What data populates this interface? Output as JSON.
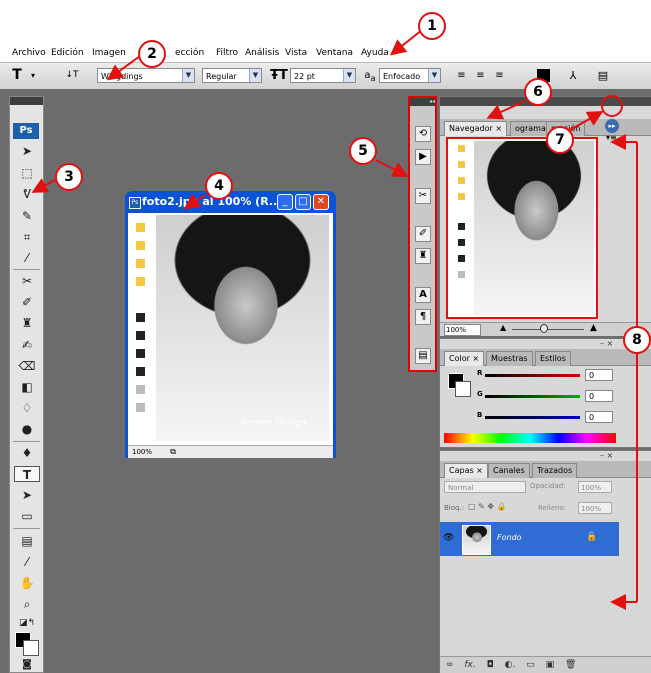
{
  "menubar": {
    "items": [
      "Archivo",
      "Edición",
      "Imagen",
      "",
      "ección",
      "Filtro",
      "Análisis",
      "Vista",
      "Ventana",
      "Ayuda"
    ]
  },
  "options": {
    "tool_glyph": "T",
    "font_family": "Wingdings",
    "font_style": "Regular",
    "font_size": "22 pt",
    "aa_label": "a",
    "aa_mode": "Enfocado"
  },
  "toolbox": {
    "logo": "Ps"
  },
  "document": {
    "title": "foto2.jpg al 100% (R...",
    "zoom": "100%",
    "swatch_colors": [
      "#f5c842",
      "#f5c842",
      "#f5c842",
      "#f5c842",
      "#222222",
      "#222222",
      "#222222",
      "#222222",
      "#bcbcbc",
      "#bcbcbc"
    ],
    "signature": "Romen Design"
  },
  "navigator": {
    "tabs": [
      "Navegador",
      "ograma",
      "mación"
    ],
    "zoom": "100%",
    "zoom_slider_level": 0.45
  },
  "color_panel": {
    "tabs": [
      "Color",
      "Muestras",
      "Estilos"
    ],
    "channels": [
      {
        "label": "R",
        "value": "0",
        "color": "#e00000"
      },
      {
        "label": "G",
        "value": "0",
        "color": "#00b000"
      },
      {
        "label": "B",
        "value": "0",
        "color": "#0000c8"
      }
    ]
  },
  "layers_panel": {
    "tabs": [
      "Capas",
      "Canales",
      "Trazados"
    ],
    "blend_mode": "Normal",
    "opacity_label": "Opacidad:",
    "opacity_value": "100%",
    "lock_label": "Bloq.:",
    "fill_label": "Relleno:",
    "fill_value": "100%",
    "layer_name": "Fondo"
  },
  "annotations": [
    "1",
    "2",
    "3",
    "4",
    "5",
    "6",
    "7",
    "8"
  ],
  "colors": {
    "annotation_red": "#e31010",
    "titlebar_blue": "#0b53d6",
    "layer_selected": "#2f6cd4",
    "workspace": "#6c6c6c"
  }
}
